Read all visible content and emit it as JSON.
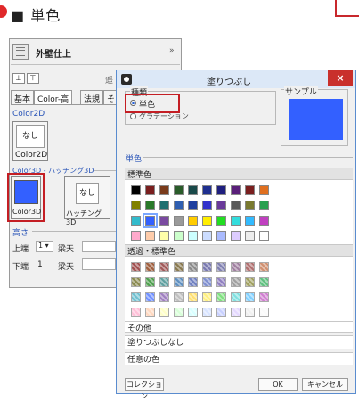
{
  "heading": {
    "text": "■ 単色"
  },
  "panel": {
    "title": "外壁仕上",
    "chevron": "»",
    "toolbar_right": "遥",
    "tabs": [
      "基本",
      "Color-高",
      "法規",
      "そ"
    ],
    "color2d_label": "Color2D",
    "color2d_none": "なし",
    "color2d_caption": "Color2D",
    "color3d_group_label": "Color3D - ハッチング3D",
    "color3d_caption": "Color3D",
    "hatch_none": "なし",
    "hatch_caption": "ハッチング3D",
    "height_label": "高さ",
    "upper_label": "上端",
    "upper_value": "1",
    "upper_ref": "梁天",
    "lower_label": "下端",
    "lower_value": "1",
    "lower_ref": "梁天",
    "color3d_swatch_color": "#3360ff"
  },
  "dialog": {
    "title": "塗りつぶし",
    "close_symbol": "×",
    "type_legend": "種類",
    "type_options": [
      "単色",
      "グラデーション"
    ],
    "type_selected": 0,
    "sample_legend": "サンプル",
    "sample_color": "#3360ff",
    "single_color_legend": "単色",
    "standard_colors_label": "標準色",
    "standard_colors": [
      [
        "#000000",
        "#7a1f1f",
        "#7a3b1c",
        "#2a5c2a",
        "#1a4a4a",
        "#1f2f8f",
        "#1f1f7f",
        "#5a1f7a",
        "#7a1f1f",
        "#e07020"
      ],
      [
        "#808000",
        "#2a7a2a",
        "#1f6f6f",
        "#2f5fb0",
        "#1f3f9f",
        "#3333cc",
        "#6a3a9a",
        "#5a5a5a",
        "#7a7a30",
        "#2aa050"
      ],
      [
        "#33bbcc",
        "#3360ff",
        "#7a4aa0",
        "#9a9a9a",
        "#ffcc00",
        "#ffee00",
        "#22dd22",
        "#33dddd",
        "#33bbff",
        "#c040c0"
      ],
      [
        "#ffaacc",
        "#ffccaa",
        "#ffffaa",
        "#ccffcc",
        "#ccffff",
        "#ccddff",
        "#aabbff",
        "#ddccff",
        "#eeeeee",
        "#ffffff"
      ]
    ],
    "selected_standard": [
      2,
      1
    ],
    "transparent_label": "透過・標準色",
    "transparent_colors": [
      [
        "#a05050",
        "#a06040",
        "#a05a5a",
        "#8a7a50",
        "#8a8a8a",
        "#7a7ab0",
        "#8080b0",
        "#a080a0",
        "#b07070",
        "#d09070"
      ],
      [
        "#8a8a50",
        "#50a050",
        "#60a0a0",
        "#6090c0",
        "#7080c0",
        "#8090d0",
        "#9080c0",
        "#a0a0a0",
        "#a0a060",
        "#60c080"
      ],
      [
        "#70c0d0",
        "#7090ff",
        "#a080c0",
        "#c0c0c0",
        "#ffe070",
        "#fff080",
        "#80e080",
        "#80e0e0",
        "#80d0ff",
        "#d080d0"
      ],
      [
        "#ffc0d8",
        "#ffd8c0",
        "#ffffc8",
        "#d8ffd8",
        "#d8ffff",
        "#d8e4ff",
        "#c8d0ff",
        "#e4d8ff",
        "#f0f0f0",
        "#fafafa"
      ]
    ],
    "other_label": "その他",
    "no_fill_label": "塗りつぶしなし",
    "custom_color_label": "任意の色",
    "collection_button": "コレクション",
    "ok_button": "OK",
    "cancel_button": "キャンセル"
  },
  "accent_color": "#c41e24"
}
